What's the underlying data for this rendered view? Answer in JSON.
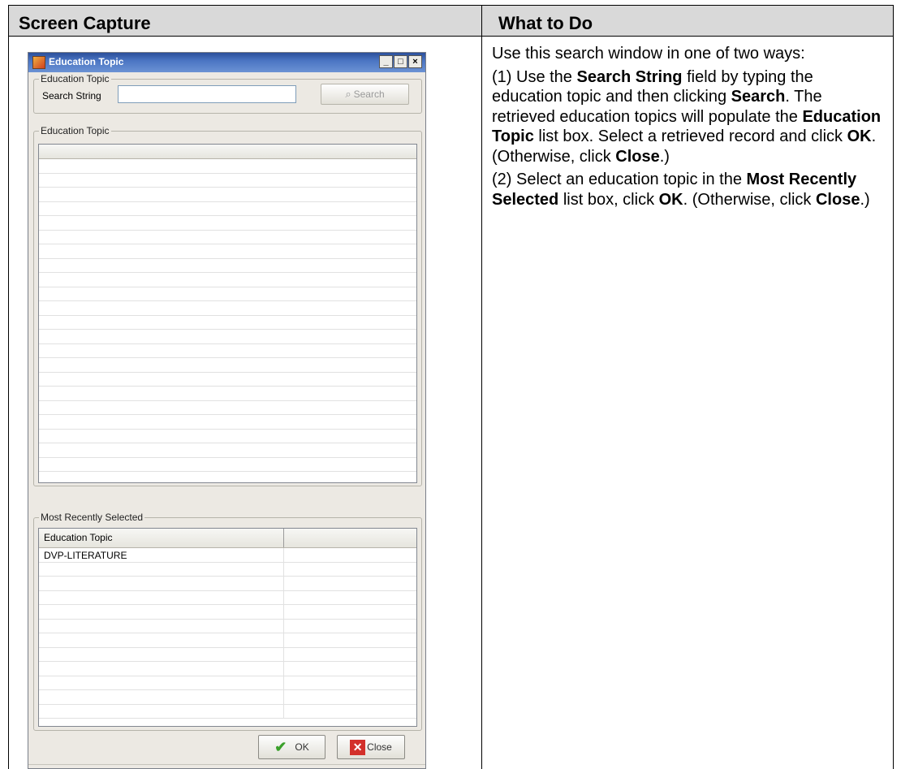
{
  "table": {
    "col1_header": "Screen Capture",
    "col2_header": "What to Do"
  },
  "dialog": {
    "title": "Education Topic",
    "search_group_label": "Education Topic",
    "search_label": "Search String",
    "search_value": "",
    "search_button": "Search",
    "results_group_label": "Education Topic",
    "recent_group_label": "Most Recently Selected",
    "recent_column_header": "Education Topic",
    "recent_rows": [
      "DVP-LITERATURE"
    ],
    "ok_button": "OK",
    "close_button": "Close"
  },
  "instructions": {
    "intro": "Use this search window in one of two ways:",
    "step1": {
      "t1": "(1) Use the ",
      "b1": "Search String",
      "t2": " field by typing the education topic and then clicking ",
      "b2": "Search",
      "t3": ". The retrieved education topics will populate the ",
      "b3": "Education Topic",
      "t4": " list box. Select a retrieved record and click ",
      "b4": "OK",
      "t5": ". (Otherwise, click ",
      "b5": "Close",
      "t6": ".)"
    },
    "step2": {
      "t1": "(2) Select an education topic in the ",
      "b1": "Most Recently Selected",
      "t2": " list box, click ",
      "b2": "OK",
      "t3": ". (Otherwise, click ",
      "b3": "Close",
      "t4": ".)"
    }
  }
}
